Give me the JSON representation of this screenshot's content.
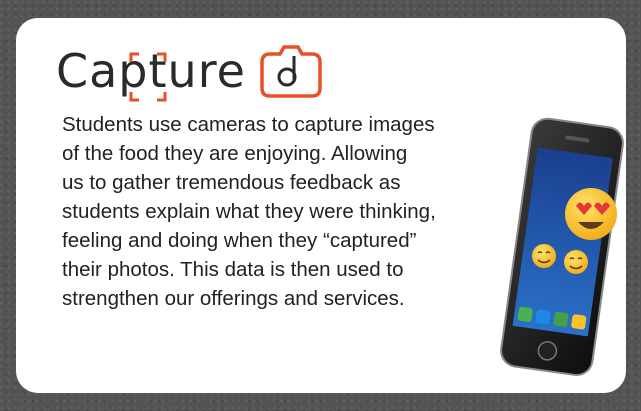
{
  "logo": {
    "text": "Capture",
    "icon": "camera-d-icon",
    "accent_color": "#e8502a",
    "text_color": "#2a2a2a"
  },
  "body": {
    "paragraph": "Students use cameras to capture images\nof the food they are enjoying. Allowing\nus to gather tremendous feedback as\nstudents explain what they were thinking,\nfeeling and doing when they “captured”\ntheir photos. This data is then used to\nstrengthen our offerings and services."
  },
  "illustration": {
    "icon": "smartphone-emoji-icon",
    "emojis": [
      "heart-eyes",
      "smiling",
      "smiling"
    ]
  },
  "colors": {
    "frame": "#545454",
    "card": "#ffffff"
  }
}
